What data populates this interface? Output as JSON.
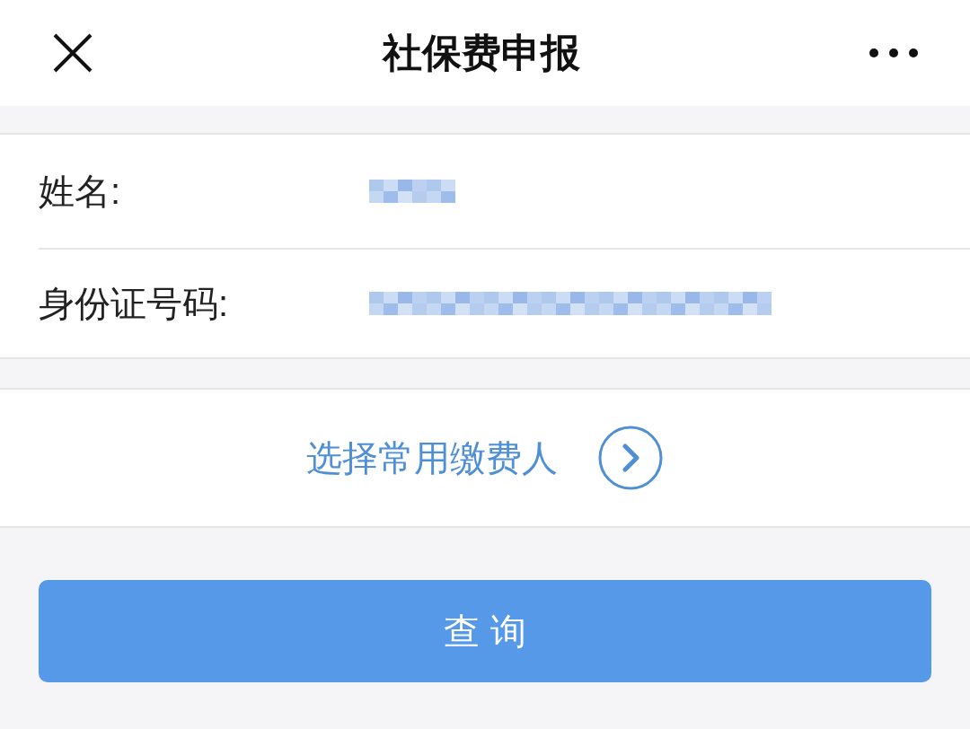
{
  "header": {
    "title": "社保费申报"
  },
  "fields": [
    {
      "label": "姓名:",
      "redacted": true
    },
    {
      "label": "身份证号码:",
      "redacted": true
    }
  ],
  "picker": {
    "label": "选择常用缴费人"
  },
  "button": {
    "label": "查 询"
  }
}
